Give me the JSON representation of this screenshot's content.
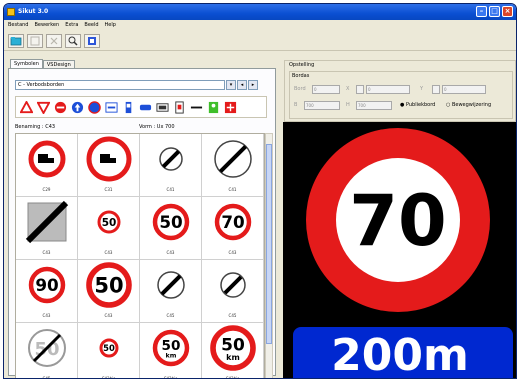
{
  "window": {
    "title": "Sikut 3.0"
  },
  "menu": [
    "Bestand",
    "Bewerken",
    "Extra",
    "Beeld",
    "Help"
  ],
  "toolbar": [
    {
      "icon": "open-icon",
      "disabled": false
    },
    {
      "icon": "save-icon",
      "disabled": true
    },
    {
      "icon": "delete-icon",
      "disabled": true
    },
    {
      "icon": "zoom-icon",
      "disabled": false
    },
    {
      "icon": "settings-icon",
      "disabled": false
    }
  ],
  "left": {
    "tabs": [
      "Symbolen",
      "VSDesign"
    ],
    "combo_value": "C - Verbodsborden",
    "benaming_label": "Benaming : C43",
    "vorm_label": "Vorm : Ux 700",
    "signs": [
      {
        "code": "C29",
        "kind": "truck"
      },
      {
        "code": "C31",
        "kind": "truck-big"
      },
      {
        "code": "C41",
        "kind": "end"
      },
      {
        "code": "C41",
        "kind": "end-big"
      },
      {
        "code": "C43",
        "kind": "end-diag"
      },
      {
        "code": "C43",
        "kind": "speed",
        "value": "50",
        "size": "small"
      },
      {
        "code": "C43",
        "kind": "speed",
        "value": "50"
      },
      {
        "code": "C43",
        "kind": "speed",
        "value": "70"
      },
      {
        "code": "C43",
        "kind": "speed",
        "value": "90"
      },
      {
        "code": "C43",
        "kind": "speed",
        "value": "50",
        "size": "big"
      },
      {
        "code": "C45",
        "kind": "end-diag-small"
      },
      {
        "code": "C45",
        "kind": "end-50"
      },
      {
        "code": "C45",
        "kind": "end-50-grey"
      },
      {
        "code": "C43bis",
        "kind": "speed",
        "value": "50",
        "size": "tiny"
      },
      {
        "code": "C43bis",
        "kind": "speed-km",
        "value": "50"
      },
      {
        "code": "C43bis",
        "kind": "speed-km",
        "value": "50",
        "size": "big"
      }
    ]
  },
  "right": {
    "group_title": "Opstelling",
    "sub_title": "Bordas",
    "labels": [
      "Bord",
      "X",
      "Y",
      "B",
      "H",
      "Publiekbord",
      "Bewegwijzering"
    ],
    "values": [
      "0",
      "0",
      "0",
      "700",
      "700"
    ],
    "preview": {
      "speed": "70",
      "distance": "200m"
    }
  },
  "colors": {
    "red": "#e41b1b",
    "blue": "#0028d0",
    "titlebar": "#0a4fd2"
  }
}
